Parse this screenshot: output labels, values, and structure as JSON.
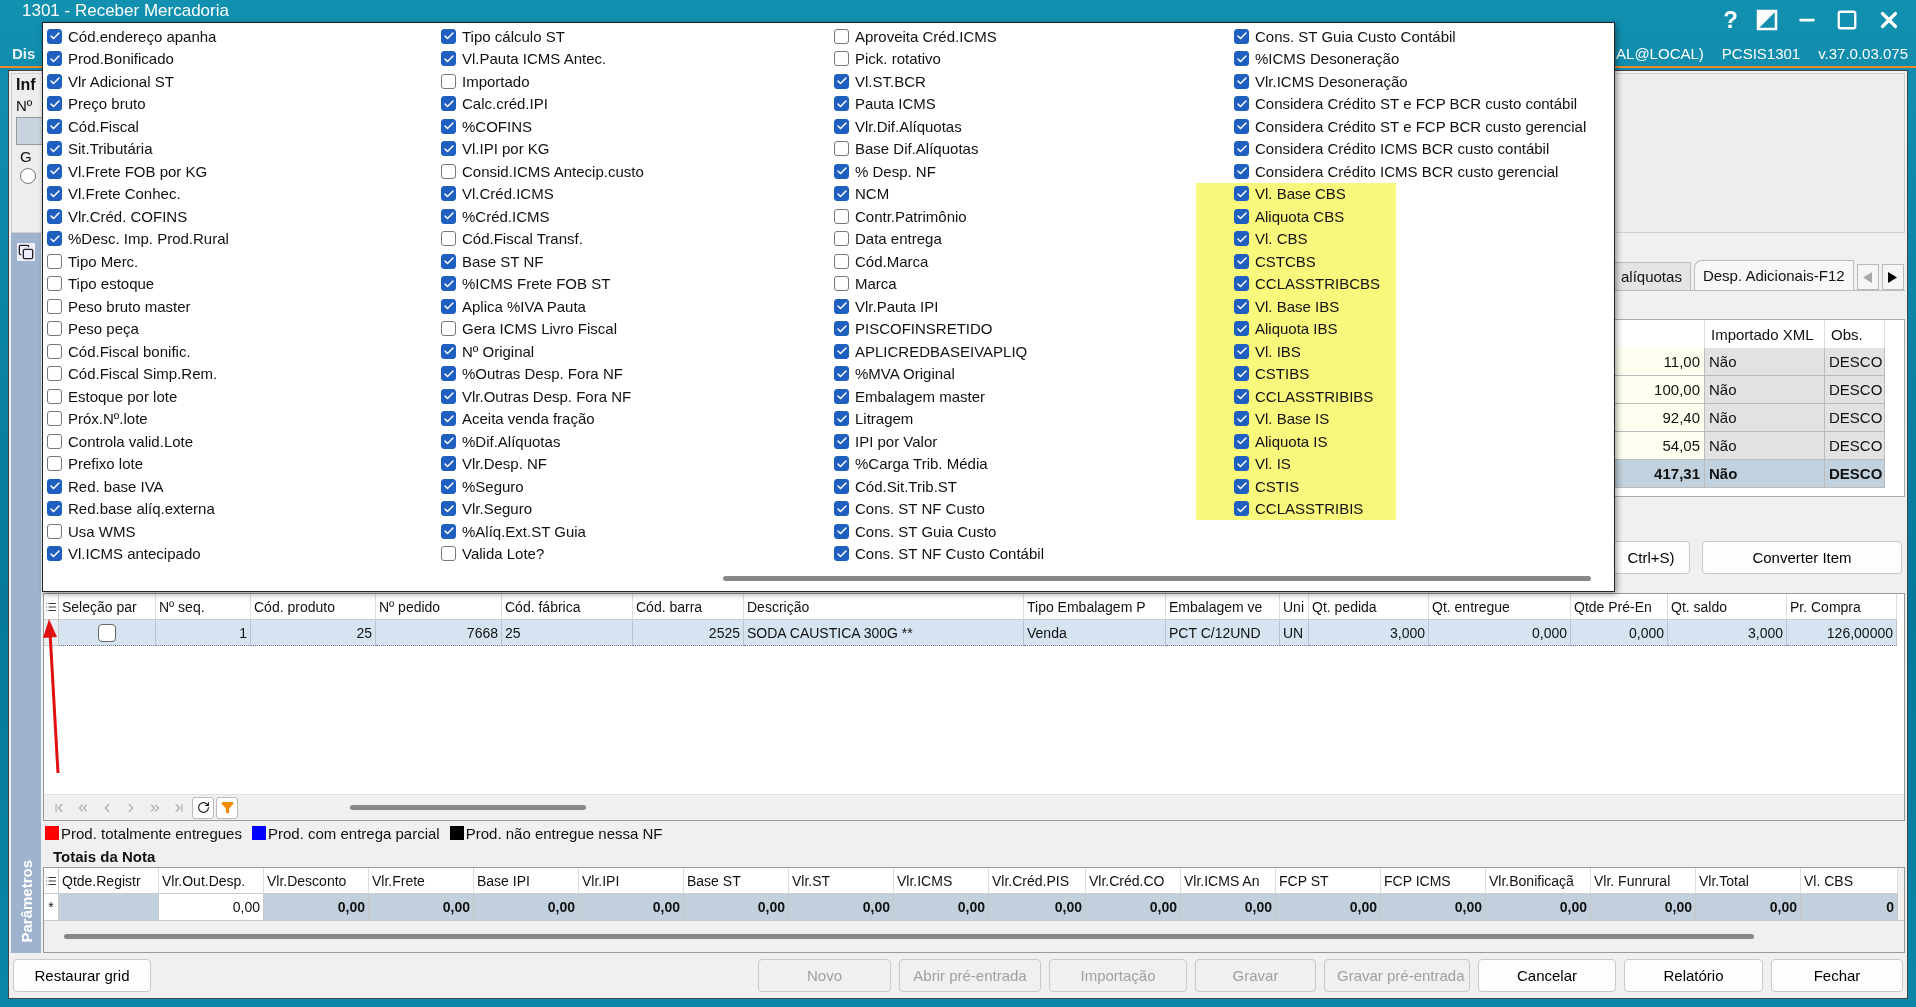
{
  "window": {
    "title": "1301 - Receber Mercadoria",
    "help": "?",
    "info_left": "Dis",
    "info_right": [
      "AL@LOCAL)",
      "PCSIS1301",
      "v.37.0.03.075"
    ]
  },
  "header_panel": {
    "group_title": "Inf",
    "field_label": "Nº",
    "group2_title": "G",
    "radio_selected": false
  },
  "column_chooser": {
    "columns": [
      [
        {
          "label": "Cód.endereço apanha",
          "checked": true,
          "highlighted": false
        },
        {
          "label": "Prod.Bonificado",
          "checked": true,
          "highlighted": false
        },
        {
          "label": "Vlr Adicional ST",
          "checked": true,
          "highlighted": false
        },
        {
          "label": "Preço bruto",
          "checked": true,
          "highlighted": false
        },
        {
          "label": "Cód.Fiscal",
          "checked": true,
          "highlighted": false
        },
        {
          "label": "Sit.Tributária",
          "checked": true,
          "highlighted": false
        },
        {
          "label": "Vl.Frete FOB por KG",
          "checked": true,
          "highlighted": false
        },
        {
          "label": "Vl.Frete Conhec.",
          "checked": true,
          "highlighted": false
        },
        {
          "label": "Vlr.Créd. COFINS",
          "checked": true,
          "highlighted": false
        },
        {
          "label": "%Desc. Imp. Prod.Rural",
          "checked": true,
          "highlighted": false
        },
        {
          "label": "Tipo Merc.",
          "checked": false,
          "highlighted": false
        },
        {
          "label": "Tipo estoque",
          "checked": false,
          "highlighted": false
        },
        {
          "label": "Peso bruto master",
          "checked": false,
          "highlighted": false
        },
        {
          "label": "Peso peça",
          "checked": false,
          "highlighted": false
        },
        {
          "label": "Cód.Fiscal bonific.",
          "checked": false,
          "highlighted": false
        },
        {
          "label": "Cód.Fiscal Simp.Rem.",
          "checked": false,
          "highlighted": false
        },
        {
          "label": "Estoque por lote",
          "checked": false,
          "highlighted": false
        },
        {
          "label": "Próx.Nº.lote",
          "checked": false,
          "highlighted": false
        },
        {
          "label": "Controla valid.Lote",
          "checked": false,
          "highlighted": false
        },
        {
          "label": "Prefixo lote",
          "checked": false,
          "highlighted": false
        },
        {
          "label": "Red. base IVA",
          "checked": true,
          "highlighted": false
        },
        {
          "label": "Red.base alíq.externa",
          "checked": true,
          "highlighted": false
        },
        {
          "label": "Usa WMS",
          "checked": false,
          "highlighted": false
        },
        {
          "label": "Vl.ICMS antecipado",
          "checked": true,
          "highlighted": false
        }
      ],
      [
        {
          "label": "Tipo cálculo ST",
          "checked": true,
          "highlighted": false
        },
        {
          "label": "Vl.Pauta ICMS Antec.",
          "checked": true,
          "highlighted": false
        },
        {
          "label": "Importado",
          "checked": false,
          "highlighted": false
        },
        {
          "label": "Calc.créd.IPI",
          "checked": true,
          "highlighted": false
        },
        {
          "label": "%COFINS",
          "checked": true,
          "highlighted": false
        },
        {
          "label": "Vl.IPI por KG",
          "checked": true,
          "highlighted": false
        },
        {
          "label": "Consid.ICMS Antecip.custo",
          "checked": false,
          "highlighted": false
        },
        {
          "label": "Vl.Créd.ICMS",
          "checked": true,
          "highlighted": false
        },
        {
          "label": "%Créd.ICMS",
          "checked": true,
          "highlighted": false
        },
        {
          "label": "Cód.Fiscal Transf.",
          "checked": false,
          "highlighted": false
        },
        {
          "label": "Base ST NF",
          "checked": true,
          "highlighted": false
        },
        {
          "label": "%ICMS Frete FOB ST",
          "checked": true,
          "highlighted": false
        },
        {
          "label": "Aplica %IVA Pauta",
          "checked": true,
          "highlighted": false
        },
        {
          "label": "Gera ICMS Livro Fiscal",
          "checked": false,
          "highlighted": false
        },
        {
          "label": "Nº Original",
          "checked": true,
          "highlighted": false
        },
        {
          "label": "%Outras Desp. Fora NF",
          "checked": true,
          "highlighted": false
        },
        {
          "label": "Vlr.Outras Desp. Fora NF",
          "checked": true,
          "highlighted": false
        },
        {
          "label": "Aceita venda fração",
          "checked": true,
          "highlighted": false
        },
        {
          "label": "%Dif.Alíquotas",
          "checked": true,
          "highlighted": false
        },
        {
          "label": "Vlr.Desp. NF",
          "checked": true,
          "highlighted": false
        },
        {
          "label": "%Seguro",
          "checked": true,
          "highlighted": false
        },
        {
          "label": "Vlr.Seguro",
          "checked": true,
          "highlighted": false
        },
        {
          "label": "%Alíq.Ext.ST Guia",
          "checked": true,
          "highlighted": false
        },
        {
          "label": "Valida Lote?",
          "checked": false,
          "highlighted": false
        }
      ],
      [
        {
          "label": "Aproveita Créd.ICMS",
          "checked": false,
          "highlighted": false
        },
        {
          "label": "Pick. rotativo",
          "checked": false,
          "highlighted": false
        },
        {
          "label": "Vl.ST.BCR",
          "checked": true,
          "highlighted": false
        },
        {
          "label": "Pauta ICMS",
          "checked": true,
          "highlighted": false
        },
        {
          "label": "Vlr.Dif.Alíquotas",
          "checked": true,
          "highlighted": false
        },
        {
          "label": "Base Dif.Alíquotas",
          "checked": false,
          "highlighted": false
        },
        {
          "label": "% Desp. NF",
          "checked": true,
          "highlighted": false
        },
        {
          "label": "NCM",
          "checked": true,
          "highlighted": false
        },
        {
          "label": "Contr.Patrimônio",
          "checked": false,
          "highlighted": false
        },
        {
          "label": "Data entrega",
          "checked": false,
          "highlighted": false
        },
        {
          "label": "Cód.Marca",
          "checked": false,
          "highlighted": false
        },
        {
          "label": "Marca",
          "checked": false,
          "highlighted": false
        },
        {
          "label": "Vlr.Pauta IPI",
          "checked": true,
          "highlighted": false
        },
        {
          "label": "PISCOFINSRETIDO",
          "checked": true,
          "highlighted": false
        },
        {
          "label": "APLICREDBASEIVAPLIQ",
          "checked": true,
          "highlighted": false
        },
        {
          "label": "%MVA Original",
          "checked": true,
          "highlighted": false
        },
        {
          "label": "Embalagem master",
          "checked": true,
          "highlighted": false
        },
        {
          "label": "Litragem",
          "checked": true,
          "highlighted": false
        },
        {
          "label": "IPI por Valor",
          "checked": true,
          "highlighted": false
        },
        {
          "label": "%Carga Trib. Média",
          "checked": true,
          "highlighted": false
        },
        {
          "label": "Cód.Sit.Trib.ST",
          "checked": true,
          "highlighted": false
        },
        {
          "label": "Cons. ST NF Custo",
          "checked": true,
          "highlighted": false
        },
        {
          "label": "Cons. ST Guia Custo",
          "checked": true,
          "highlighted": false
        },
        {
          "label": "Cons. ST NF Custo Contábil",
          "checked": true,
          "highlighted": false
        }
      ],
      [
        {
          "label": "Cons. ST Guia Custo Contábil",
          "checked": true,
          "highlighted": false
        },
        {
          "label": "%ICMS Desoneração",
          "checked": true,
          "highlighted": false
        },
        {
          "label": "Vlr.ICMS Desoneração",
          "checked": true,
          "highlighted": false
        },
        {
          "label": "Considera Crédito ST e FCP BCR custo contábil",
          "checked": true,
          "highlighted": false
        },
        {
          "label": "Considera Crédito ST e FCP BCR custo gerencial",
          "checked": true,
          "highlighted": false
        },
        {
          "label": "Considera Crédito ICMS BCR custo contábil",
          "checked": true,
          "highlighted": false
        },
        {
          "label": "Considera Crédito ICMS BCR custo gerencial",
          "checked": true,
          "highlighted": false
        },
        {
          "label": "Vl. Base CBS",
          "checked": true,
          "highlighted": true
        },
        {
          "label": "Aliquota CBS",
          "checked": true,
          "highlighted": true
        },
        {
          "label": "Vl. CBS",
          "checked": true,
          "highlighted": true
        },
        {
          "label": "CSTCBS",
          "checked": true,
          "highlighted": true
        },
        {
          "label": "CCLASSTRIBCBS",
          "checked": true,
          "highlighted": true
        },
        {
          "label": "Vl. Base IBS",
          "checked": true,
          "highlighted": true
        },
        {
          "label": "Aliquota IBS",
          "checked": true,
          "highlighted": true
        },
        {
          "label": "Vl. IBS",
          "checked": true,
          "highlighted": true
        },
        {
          "label": "CSTIBS",
          "checked": true,
          "highlighted": true
        },
        {
          "label": "CCLASSTRIBIBS",
          "checked": true,
          "highlighted": true
        },
        {
          "label": "Vl. Base IS",
          "checked": true,
          "highlighted": true
        },
        {
          "label": "Aliquota IS",
          "checked": true,
          "highlighted": true
        },
        {
          "label": "Vl. IS",
          "checked": true,
          "highlighted": true
        },
        {
          "label": "CSTIS",
          "checked": true,
          "highlighted": true
        },
        {
          "label": "CCLASSTRIBIS",
          "checked": true,
          "highlighted": true
        }
      ]
    ]
  },
  "side_panel": {
    "tabs": [
      {
        "label": "alíquotas",
        "selected": false
      },
      {
        "label": "Desp. Adicionais-F12",
        "selected": true
      }
    ],
    "grid": {
      "headers": [
        "Importado XML",
        "Obs."
      ],
      "rows": [
        {
          "cells": [
            "11,00",
            "Não",
            "DESCO"
          ],
          "selected": false
        },
        {
          "cells": [
            "100,00",
            "Não",
            "DESCO"
          ],
          "selected": false
        },
        {
          "cells": [
            "92,40",
            "Não",
            "DESCO"
          ],
          "selected": false
        },
        {
          "cells": [
            "54,05",
            "Não",
            "DESCO"
          ],
          "selected": false
        },
        {
          "cells": [
            "417,31",
            "Não",
            "DESCO"
          ],
          "selected": true
        }
      ]
    },
    "buttons": [
      "Ctrl+S)",
      "Converter Item"
    ]
  },
  "main_grid": {
    "selection_header": "Seleção par",
    "columns": [
      "Nº seq.",
      "Cód. produto",
      "Nº pedido",
      "Cód. fábrica",
      "Cód. barra",
      "Descrição",
      "Tipo Embalagem P",
      "Embalagem ve",
      "Uni",
      "Qt. pedida",
      "Qt. entregue",
      "Qtde Pré-En",
      "Qt. saldo",
      "Pr. Compra"
    ],
    "rows": [
      {
        "selected": true,
        "checked": false,
        "cells": [
          "1",
          "25",
          "7668",
          "25",
          "2525",
          "SODA CAUSTICA 300G **",
          "Venda",
          "PCT C/12UND",
          "UN",
          "3,000",
          "0,000",
          "0,000",
          "3,000",
          "126,00000"
        ]
      }
    ]
  },
  "legend": [
    {
      "label": "Prod. totalmente entregues",
      "color": "#ff0000"
    },
    {
      "label": "Prod. com entrega parcial",
      "color": "#0000ff"
    },
    {
      "label": "Prod. não entregue nessa NF",
      "color": "#000000"
    }
  ],
  "totals": {
    "title": "Totais da Nota",
    "columns": [
      "Qtde.Registr",
      "Vlr.Out.Desp.",
      "Vlr.Desconto",
      "Vlr.Frete",
      "Base IPI",
      "Vlr.IPI",
      "Base ST",
      "Vlr.ST",
      "Vlr.ICMS",
      "Vlr.Créd.PIS",
      "Vlr.Créd.CO",
      "Vlr.ICMS An",
      "FCP ST",
      "FCP ICMS",
      "Vlr.Bonificaçã",
      "Vlr. Funrural",
      "Vlr.Total",
      "Vl. CBS"
    ],
    "rows": [
      {
        "marker": "*",
        "cells": [
          "",
          "0,00",
          "0,00",
          "0,00",
          "0,00",
          "0,00",
          "0,00",
          "0,00",
          "0,00",
          "0,00",
          "0,00",
          "0,00",
          "0,00",
          "0,00",
          "0,00",
          "0,00",
          "0,00",
          "0"
        ],
        "editable": [
          false,
          true,
          false,
          false,
          false,
          false,
          false,
          false,
          false,
          false,
          false,
          false,
          false,
          false,
          false,
          false,
          false,
          false
        ]
      }
    ]
  },
  "sidebar": {
    "label": "Parâmetros"
  },
  "restore_grid_button": "Restaurar grid",
  "buttons": [
    {
      "label": "Novo",
      "disabled": true
    },
    {
      "label": "Abrir pré-entrada",
      "disabled": true
    },
    {
      "label": "Importação",
      "disabled": true
    },
    {
      "label": "Gravar",
      "disabled": true
    },
    {
      "label": "Gravar pré-entrada",
      "disabled": true
    },
    {
      "label": "Cancelar",
      "disabled": false
    },
    {
      "label": "Relatório",
      "disabled": false
    },
    {
      "label": "Fechar",
      "disabled": false
    }
  ]
}
